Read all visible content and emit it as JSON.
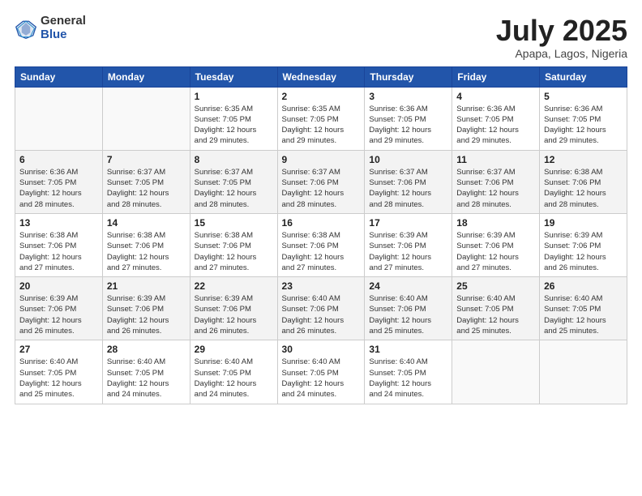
{
  "logo": {
    "general": "General",
    "blue": "Blue"
  },
  "header": {
    "month": "July 2025",
    "location": "Apapa, Lagos, Nigeria"
  },
  "weekdays": [
    "Sunday",
    "Monday",
    "Tuesday",
    "Wednesday",
    "Thursday",
    "Friday",
    "Saturday"
  ],
  "weeks": [
    [
      {
        "day": "",
        "info": ""
      },
      {
        "day": "",
        "info": ""
      },
      {
        "day": "1",
        "info": "Sunrise: 6:35 AM\nSunset: 7:05 PM\nDaylight: 12 hours\nand 29 minutes."
      },
      {
        "day": "2",
        "info": "Sunrise: 6:35 AM\nSunset: 7:05 PM\nDaylight: 12 hours\nand 29 minutes."
      },
      {
        "day": "3",
        "info": "Sunrise: 6:36 AM\nSunset: 7:05 PM\nDaylight: 12 hours\nand 29 minutes."
      },
      {
        "day": "4",
        "info": "Sunrise: 6:36 AM\nSunset: 7:05 PM\nDaylight: 12 hours\nand 29 minutes."
      },
      {
        "day": "5",
        "info": "Sunrise: 6:36 AM\nSunset: 7:05 PM\nDaylight: 12 hours\nand 29 minutes."
      }
    ],
    [
      {
        "day": "6",
        "info": "Sunrise: 6:36 AM\nSunset: 7:05 PM\nDaylight: 12 hours\nand 28 minutes."
      },
      {
        "day": "7",
        "info": "Sunrise: 6:37 AM\nSunset: 7:05 PM\nDaylight: 12 hours\nand 28 minutes."
      },
      {
        "day": "8",
        "info": "Sunrise: 6:37 AM\nSunset: 7:05 PM\nDaylight: 12 hours\nand 28 minutes."
      },
      {
        "day": "9",
        "info": "Sunrise: 6:37 AM\nSunset: 7:06 PM\nDaylight: 12 hours\nand 28 minutes."
      },
      {
        "day": "10",
        "info": "Sunrise: 6:37 AM\nSunset: 7:06 PM\nDaylight: 12 hours\nand 28 minutes."
      },
      {
        "day": "11",
        "info": "Sunrise: 6:37 AM\nSunset: 7:06 PM\nDaylight: 12 hours\nand 28 minutes."
      },
      {
        "day": "12",
        "info": "Sunrise: 6:38 AM\nSunset: 7:06 PM\nDaylight: 12 hours\nand 28 minutes."
      }
    ],
    [
      {
        "day": "13",
        "info": "Sunrise: 6:38 AM\nSunset: 7:06 PM\nDaylight: 12 hours\nand 27 minutes."
      },
      {
        "day": "14",
        "info": "Sunrise: 6:38 AM\nSunset: 7:06 PM\nDaylight: 12 hours\nand 27 minutes."
      },
      {
        "day": "15",
        "info": "Sunrise: 6:38 AM\nSunset: 7:06 PM\nDaylight: 12 hours\nand 27 minutes."
      },
      {
        "day": "16",
        "info": "Sunrise: 6:38 AM\nSunset: 7:06 PM\nDaylight: 12 hours\nand 27 minutes."
      },
      {
        "day": "17",
        "info": "Sunrise: 6:39 AM\nSunset: 7:06 PM\nDaylight: 12 hours\nand 27 minutes."
      },
      {
        "day": "18",
        "info": "Sunrise: 6:39 AM\nSunset: 7:06 PM\nDaylight: 12 hours\nand 27 minutes."
      },
      {
        "day": "19",
        "info": "Sunrise: 6:39 AM\nSunset: 7:06 PM\nDaylight: 12 hours\nand 26 minutes."
      }
    ],
    [
      {
        "day": "20",
        "info": "Sunrise: 6:39 AM\nSunset: 7:06 PM\nDaylight: 12 hours\nand 26 minutes."
      },
      {
        "day": "21",
        "info": "Sunrise: 6:39 AM\nSunset: 7:06 PM\nDaylight: 12 hours\nand 26 minutes."
      },
      {
        "day": "22",
        "info": "Sunrise: 6:39 AM\nSunset: 7:06 PM\nDaylight: 12 hours\nand 26 minutes."
      },
      {
        "day": "23",
        "info": "Sunrise: 6:40 AM\nSunset: 7:06 PM\nDaylight: 12 hours\nand 26 minutes."
      },
      {
        "day": "24",
        "info": "Sunrise: 6:40 AM\nSunset: 7:06 PM\nDaylight: 12 hours\nand 25 minutes."
      },
      {
        "day": "25",
        "info": "Sunrise: 6:40 AM\nSunset: 7:05 PM\nDaylight: 12 hours\nand 25 minutes."
      },
      {
        "day": "26",
        "info": "Sunrise: 6:40 AM\nSunset: 7:05 PM\nDaylight: 12 hours\nand 25 minutes."
      }
    ],
    [
      {
        "day": "27",
        "info": "Sunrise: 6:40 AM\nSunset: 7:05 PM\nDaylight: 12 hours\nand 25 minutes."
      },
      {
        "day": "28",
        "info": "Sunrise: 6:40 AM\nSunset: 7:05 PM\nDaylight: 12 hours\nand 24 minutes."
      },
      {
        "day": "29",
        "info": "Sunrise: 6:40 AM\nSunset: 7:05 PM\nDaylight: 12 hours\nand 24 minutes."
      },
      {
        "day": "30",
        "info": "Sunrise: 6:40 AM\nSunset: 7:05 PM\nDaylight: 12 hours\nand 24 minutes."
      },
      {
        "day": "31",
        "info": "Sunrise: 6:40 AM\nSunset: 7:05 PM\nDaylight: 12 hours\nand 24 minutes."
      },
      {
        "day": "",
        "info": ""
      },
      {
        "day": "",
        "info": ""
      }
    ]
  ]
}
